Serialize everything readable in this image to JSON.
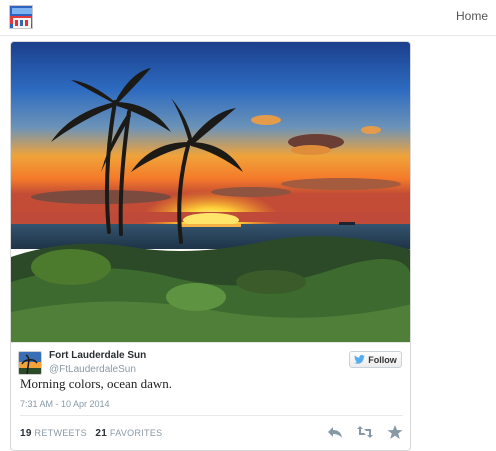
{
  "nav": {
    "home_label": "Home"
  },
  "logo": {
    "icon": "site-logo-icon"
  },
  "tweet": {
    "author_name": "Fort Lauderdale Sun",
    "author_handle": "@FtLauderdaleSun",
    "follow_label": "Follow",
    "text": "Morning colors, ocean dawn.",
    "timestamp": "7:31 AM - 10 Apr 2014",
    "retweets_count": "19",
    "retweets_label": "RETWEETS",
    "favorites_count": "21",
    "favorites_label": "FAVORITES"
  },
  "colors": {
    "twitter_blue": "#55acee",
    "muted_text": "#8899a6",
    "name_text": "#292f33"
  }
}
